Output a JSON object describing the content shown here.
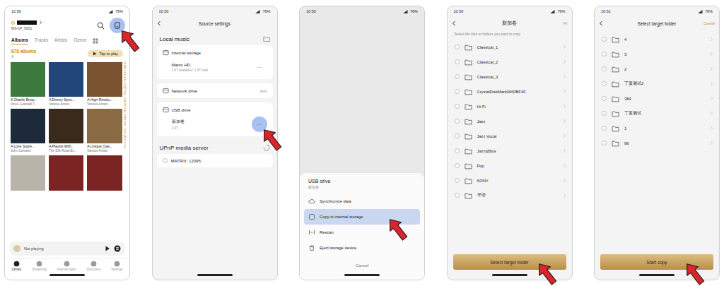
{
  "library": {
    "status": {
      "time": "10:50",
      "battery": "76%"
    },
    "device": {
      "name": "MS-1P_5001"
    },
    "source_button": {
      "highlighted": true,
      "marked": true
    },
    "tabs": [
      {
        "label": "Albums",
        "selected": true
      },
      {
        "label": "Tracks",
        "selected": false
      },
      {
        "label": "Artists",
        "selected": false
      },
      {
        "label": "Genre",
        "selected": false
      }
    ],
    "count": "878 albums",
    "section": "A",
    "play_button": "Tap to play",
    "index": "ABCDEFGHIJKLMNOPQRSTUVWXYZ",
    "albums": [
      {
        "kind": "full",
        "title": "A Charlie Brow...",
        "artist": "Vince Guaraldi T..."
      },
      {
        "kind": "full",
        "title": "A Disney Spec...",
        "artist": "Various Artists"
      },
      {
        "kind": "full",
        "title": "A High-Resolu...",
        "artist": "Various Artists"
      },
      {
        "kind": "full",
        "title": "A Love Supre...",
        "artist": "John Coltrane"
      },
      {
        "kind": "full",
        "title": "A Playlist With...",
        "artist": "The Silk Road En..."
      },
      {
        "kind": "full",
        "title": "A Unique Clas...",
        "artist": "Various Artists"
      },
      {
        "kind": "cover"
      },
      {
        "kind": "cover"
      },
      {
        "kind": "cover"
      }
    ],
    "player": {
      "text": "Not playing"
    },
    "nav": [
      {
        "label": "Library",
        "selected": true
      },
      {
        "label": "Streaming",
        "selected": false
      },
      {
        "label": "Internet radio",
        "selected": false
      },
      {
        "label": "Discovery",
        "selected": false
      },
      {
        "label": "Settings",
        "selected": false
      }
    ]
  },
  "source_settings": {
    "status": {
      "time": "10:50",
      "battery": "76%"
    },
    "title": "Source settings",
    "local_title": "Local music",
    "storages": [
      {
        "label": "Internal storage",
        "devices": [
          {
            "name": "Matrix HD",
            "detail": "1.8T available / 1.8T total",
            "menu": "···",
            "highlighted": false,
            "marked": false
          }
        ]
      },
      {
        "label": "Network drive",
        "action": "Add",
        "devices": []
      },
      {
        "label": "USB drive",
        "devices": [
          {
            "name": "新加卷",
            "detail": "1.9T",
            "menu": "···",
            "highlighted": true,
            "marked": true
          }
        ]
      }
    ],
    "upnp": {
      "title": "UPnP media server",
      "servers": [
        {
          "name": "MATRIX: 12095:",
          "selected": false
        }
      ]
    }
  },
  "action_sheet": {
    "status": {
      "time": "10:50",
      "battery": "76%"
    },
    "title": "USB drive",
    "subtitle": "新加卷",
    "items": [
      {
        "label": "Synchronize data",
        "highlighted": false,
        "marked": false
      },
      {
        "label": "Copy to internal storage",
        "highlighted": true,
        "marked": true
      },
      {
        "label": "Rescan",
        "highlighted": false,
        "marked": false
      },
      {
        "label": "Eject storage device",
        "highlighted": false,
        "marked": false
      }
    ],
    "cancel": "Cancel"
  },
  "file_picker": {
    "status": {
      "time": "10:50",
      "battery": "76%"
    },
    "title": "新加卷",
    "action": "All",
    "hint": "Select the files or folders you want to copy",
    "folders": [
      {
        "name": "Classical_1",
        "checked": false
      },
      {
        "name": "Classical_2",
        "checked": false
      },
      {
        "name": "Classical_3",
        "checked": false
      },
      {
        "name": "CrystalDiskMark0000BF4F",
        "checked": false
      },
      {
        "name": "Hi-Fi",
        "checked": false
      },
      {
        "name": "Jazz",
        "checked": false
      },
      {
        "name": "Jazz Vocal",
        "checked": false
      },
      {
        "name": "Jazz&Blus",
        "checked": false
      },
      {
        "name": "Pop",
        "checked": false
      },
      {
        "name": "SONY",
        "checked": false
      },
      {
        "name": "华语",
        "checked": false
      }
    ],
    "button": {
      "label": "Select target folder",
      "marked": true
    }
  },
  "target_picker": {
    "status": {
      "time": "10:51",
      "battery": "76%"
    },
    "title": "Select target folder",
    "action": "Create",
    "folders": [
      {
        "name": "4",
        "checked": false
      },
      {
        "name": "3",
        "checked": false
      },
      {
        "name": "2",
        "checked": false
      },
      {
        "name": "丁黄测试2",
        "checked": false
      },
      {
        "name": "384",
        "checked": false
      },
      {
        "name": "丁黄测试",
        "checked": false
      },
      {
        "name": "1",
        "checked": false
      },
      {
        "name": "96",
        "checked": false
      }
    ],
    "button": {
      "label": "Start copy",
      "marked": true
    }
  }
}
